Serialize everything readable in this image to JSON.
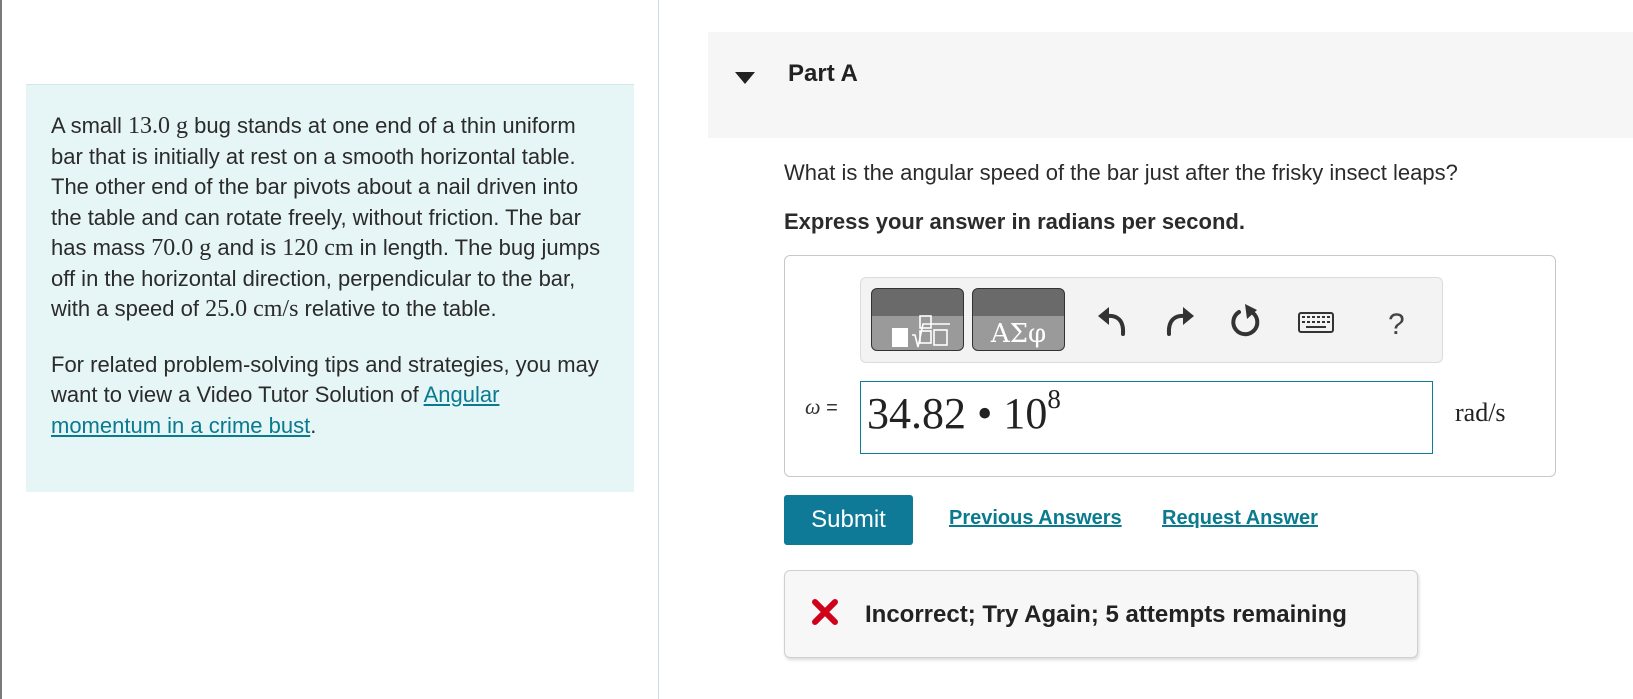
{
  "problem": {
    "text_1": "A small ",
    "bug_mass": "13.0 g",
    "text_2": " bug stands at one end of a thin uniform bar that is initially at rest on a smooth horizontal table. The other end of the bar pivots about a nail driven into the table and can rotate freely, without friction. The bar has mass ",
    "bar_mass": "70.0 g",
    "text_3": " and is ",
    "bar_length": "120 cm",
    "text_4": " in length. The bug jumps off in the horizontal direction, perpendicular to the bar, with a speed of ",
    "bug_speed": "25.0 cm/s",
    "text_5": " relative to the table.",
    "related_text": "For related problem-solving tips and strategies, you may want to view a Video Tutor Solution of ",
    "related_link": "Angular momentum in a crime bust",
    "related_end": "."
  },
  "part": {
    "title": "Part A",
    "question": "What is the angular speed of the bar just after the frisky insect leaps?",
    "instruction": "Express your answer in radians per second."
  },
  "toolbar": {
    "greek_label": "ΑΣφ",
    "help_label": "?",
    "icons": [
      "templates-icon",
      "greek-letters-icon",
      "undo-icon",
      "redo-icon",
      "reset-icon",
      "keyboard-icon",
      "help-icon"
    ]
  },
  "answer": {
    "variable": "ω",
    "equals": " =",
    "mantissa": "34.82 • 10",
    "exponent": "8",
    "units": "rad/s"
  },
  "actions": {
    "submit_label": "Submit",
    "previous_answers": "Previous Answers",
    "request_answer": "Request Answer"
  },
  "feedback": {
    "message": "Incorrect; Try Again; 5 attempts remaining"
  },
  "colors": {
    "accent": "#0e7a98",
    "problem_background": "#e6f5f6",
    "error": "#d0021b",
    "link": "#0a7a8f"
  }
}
